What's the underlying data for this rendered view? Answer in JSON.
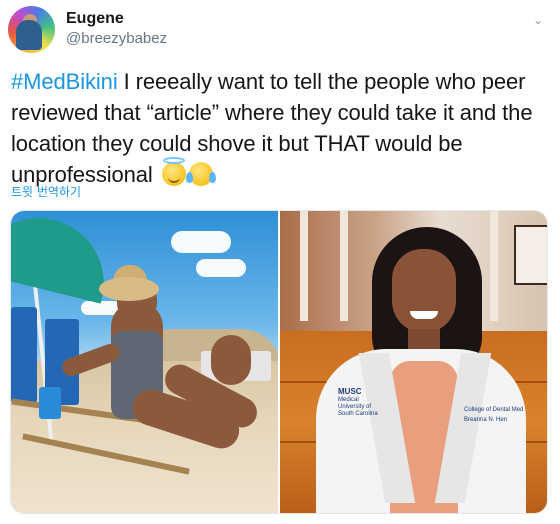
{
  "author": {
    "display_name": "Eugene",
    "handle": "@breezybabez"
  },
  "tweet": {
    "hashtag": "#MedBikini",
    "text": " I reeeally want to tell the people who peer reviewed that “article”  where they could take it and the location they could shove it but THAT would be unprofessional",
    "emoji_1": "smiling-face-with-halo",
    "emoji_2": "face-with-tears-of-joy"
  },
  "translate_link": "트윗 번역하기",
  "media": {
    "photo_1": "beach-bikini-photo",
    "photo_2": "white-coat-portrait-photo",
    "coat_logo": "MUSC",
    "coat_logo_sub": "Medical University of South Carolina",
    "coat_name_line1": "College of Dental Med",
    "coat_name_line2": "Breanna N. Hen"
  },
  "colors": {
    "link": "#1b95e0",
    "text": "#14171a",
    "secondary": "#657786"
  }
}
